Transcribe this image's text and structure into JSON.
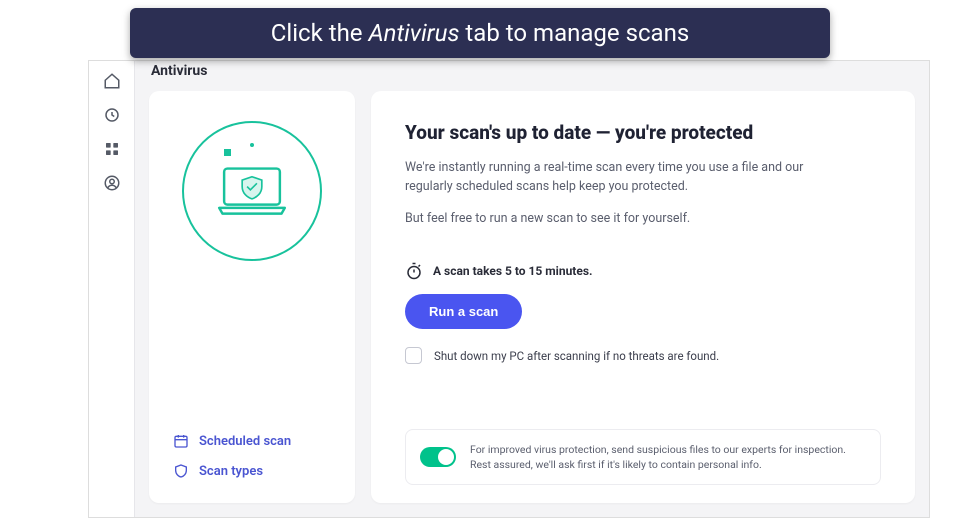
{
  "banner": {
    "prefix": "Click the ",
    "emphasis": "Antivirus",
    "suffix": " tab to manage scans"
  },
  "page": {
    "title": "Antivirus"
  },
  "leftCard": {
    "links": {
      "scheduled": "Scheduled scan",
      "types": "Scan types"
    }
  },
  "main": {
    "headline": "Your scan's up to date — you're protected",
    "desc1": "We're instantly running a real-time scan every time you use a file and our regularly scheduled scans help keep you protected.",
    "desc2": "But feel free to run a new scan to see it for yourself.",
    "scanTime": "A scan takes 5 to 15 minutes.",
    "runScan": "Run a scan",
    "shutdownLabel": "Shut down my PC after scanning if no threats are found.",
    "footerText": "For improved virus protection, send suspicious files to our experts for inspection. Rest assured, we'll ask first if it's likely to contain personal info."
  }
}
